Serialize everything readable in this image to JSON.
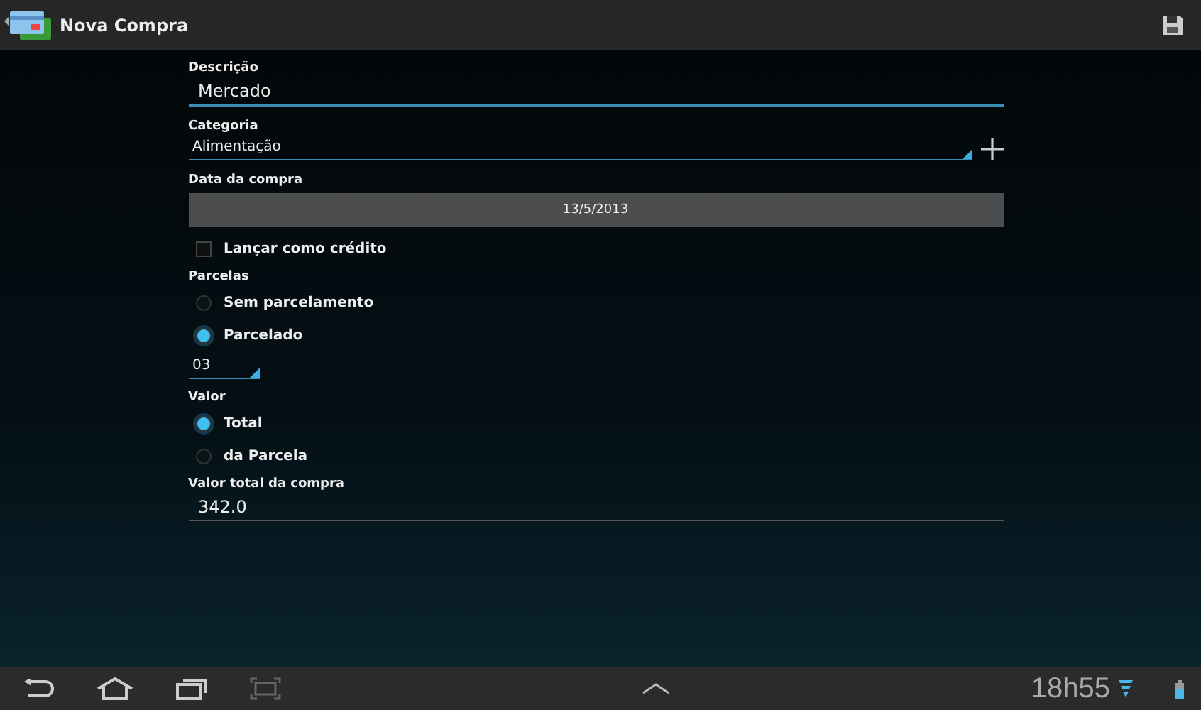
{
  "action_bar": {
    "title": "Nova Compra"
  },
  "form": {
    "description": {
      "label": "Descrição",
      "value": "Mercado"
    },
    "category": {
      "label": "Categoria",
      "value": "Alimentação"
    },
    "date": {
      "label": "Data da compra",
      "value": "13/5/2013"
    },
    "credit": {
      "label": "Lançar como crédito",
      "checked": false
    },
    "installments": {
      "label": "Parcelas",
      "options": [
        {
          "label": "Sem parcelamento",
          "selected": false
        },
        {
          "label": "Parcelado",
          "selected": true
        }
      ],
      "count": "03"
    },
    "value_type": {
      "label": "Valor",
      "options": [
        {
          "label": "Total",
          "selected": true
        },
        {
          "label": "da Parcela",
          "selected": false
        }
      ]
    },
    "total": {
      "label": "Valor total da compra",
      "value": "342.0"
    }
  },
  "status_bar": {
    "time": "18h55"
  }
}
